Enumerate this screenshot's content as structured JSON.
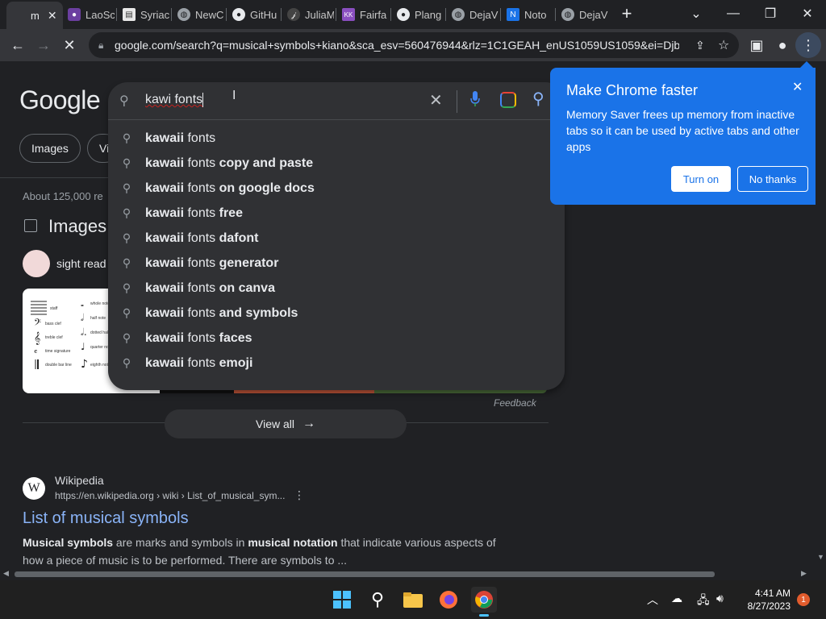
{
  "tabs": [
    {
      "label": "m",
      "active": true
    },
    {
      "label": "LaoSc"
    },
    {
      "label": "Syriac"
    },
    {
      "label": "NewC"
    },
    {
      "label": "GitHu"
    },
    {
      "label": "JuliaM"
    },
    {
      "label": "Fairfa"
    },
    {
      "label": "Plang"
    },
    {
      "label": "DejaV"
    },
    {
      "label": "Noto"
    },
    {
      "label": "DejaV"
    }
  ],
  "window": {
    "new_tab": "+",
    "dropdown": "⌄",
    "minimize": "—",
    "maximize": "❐",
    "close": "✕"
  },
  "toolbar": {
    "url": "google.com/search?q=musical+symbols+kiano&sca_esv=560476944&rlz=1C1GEAH_enUS1059US1059&ei=Djbr..."
  },
  "google": {
    "logo": "Google",
    "query": "kawi fonts",
    "chips": [
      "Images",
      "Vi"
    ],
    "result_stats": "About 125,000 re",
    "images_heading": "Images",
    "image_chip": "sight read",
    "feedback": "Feedback",
    "view_all": "View all"
  },
  "suggestions": [
    {
      "bold": "kawaii",
      "plain": " fonts",
      "bold2": ""
    },
    {
      "bold": "kawaii",
      "plain": " fonts",
      "bold2": " copy and paste"
    },
    {
      "bold": "kawaii",
      "plain": " fonts",
      "bold2": " on google docs"
    },
    {
      "bold": "kawaii",
      "plain": " fonts",
      "bold2": " free"
    },
    {
      "bold": "kawaii",
      "plain": " fonts",
      "bold2": " dafont"
    },
    {
      "bold": "kawaii",
      "plain": " fonts",
      "bold2": " generator"
    },
    {
      "bold": "kawaii",
      "plain": " fonts",
      "bold2": " on canva"
    },
    {
      "bold": "kawaii",
      "plain": " fonts",
      "bold2": " and symbols"
    },
    {
      "bold": "kawaii",
      "plain": " fonts",
      "bold2": " faces"
    },
    {
      "bold": "kawaii",
      "plain": " fonts",
      "bold2": " emoji"
    }
  ],
  "result": {
    "site": "Wikipedia",
    "favicon": "W",
    "url": "https://en.wikipedia.org › wiki › List_of_musical_sym...",
    "title": "List of musical symbols",
    "snippet_1a": "Musical symbols",
    "snippet_1b": " are marks and symbols in ",
    "snippet_1c": "musical notation",
    "snippet_1d": " that indicate various aspects of",
    "snippet_2": "how a piece of music is to be performed. There are symbols to ..."
  },
  "promo": {
    "title": "Make Chrome faster",
    "body": "Memory Saver frees up memory from inactive tabs so it can be used by active tabs and other apps",
    "turn_on": "Turn on",
    "no_thanks": "No thanks"
  },
  "thumb_labels": [
    "staff",
    "bass clef",
    "treble clef",
    "time signature",
    "double bar line",
    "whole note",
    "half note",
    "dotted half note",
    "quarter note",
    "eighth note"
  ],
  "taskbar": {
    "time": "4:41 AM",
    "date": "8/27/2023",
    "notification_count": "1"
  },
  "colors": {
    "accent": "#1a73e8",
    "link": "#8ab4f8",
    "bg": "#202124",
    "surface": "#303134"
  }
}
